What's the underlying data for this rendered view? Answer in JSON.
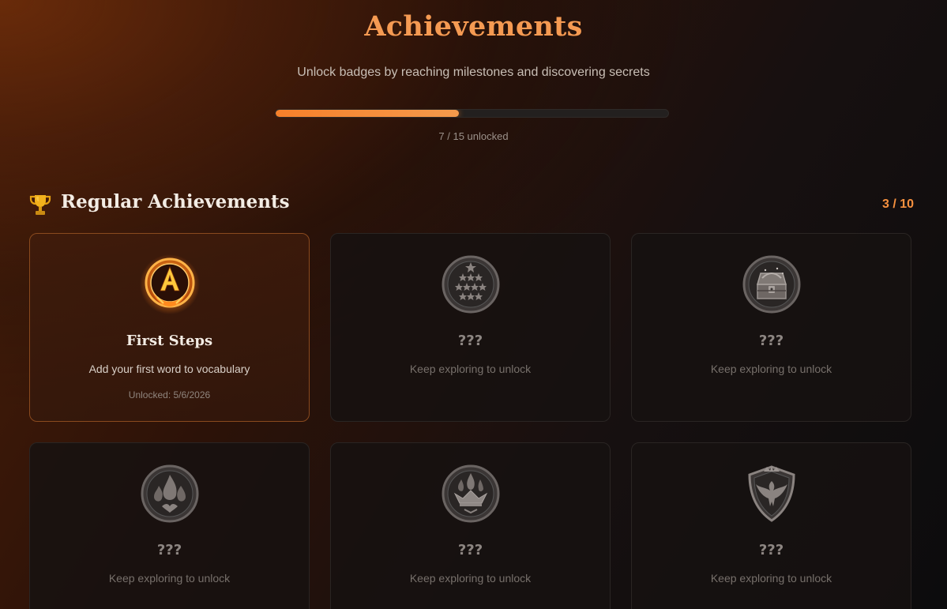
{
  "header": {
    "title": "Achievements",
    "subtitle": "Unlock badges by reaching milestones and discovering secrets",
    "progress_text": "7 / 15 unlocked",
    "progress_fraction": 0.4667
  },
  "section": {
    "icon": "trophy-icon",
    "title": "Regular Achievements",
    "count": "3 / 10"
  },
  "cards": [
    {
      "icon": "phoenix-letter-a-badge-icon",
      "title": "First Steps",
      "description": "Add your first word to vocabulary",
      "date": "Unlocked: 5/6/2026",
      "unlocked": true
    },
    {
      "icon": "stars-badge-icon",
      "title": "???",
      "description": "Keep exploring to unlock",
      "unlocked": false
    },
    {
      "icon": "treasure-chest-badge-icon",
      "title": "???",
      "description": "Keep exploring to unlock",
      "unlocked": false
    },
    {
      "icon": "flames-badge-icon",
      "title": "???",
      "description": "Keep exploring to unlock",
      "unlocked": false
    },
    {
      "icon": "flaming-crown-badge-icon",
      "title": "???",
      "description": "Keep exploring to unlock",
      "unlocked": false
    },
    {
      "icon": "phoenix-shield-badge-icon",
      "title": "???",
      "description": "Keep exploring to unlock",
      "unlocked": false
    }
  ],
  "colors": {
    "accent": "#f59a52",
    "progress": "#f7802a",
    "count": "#f7913f"
  }
}
